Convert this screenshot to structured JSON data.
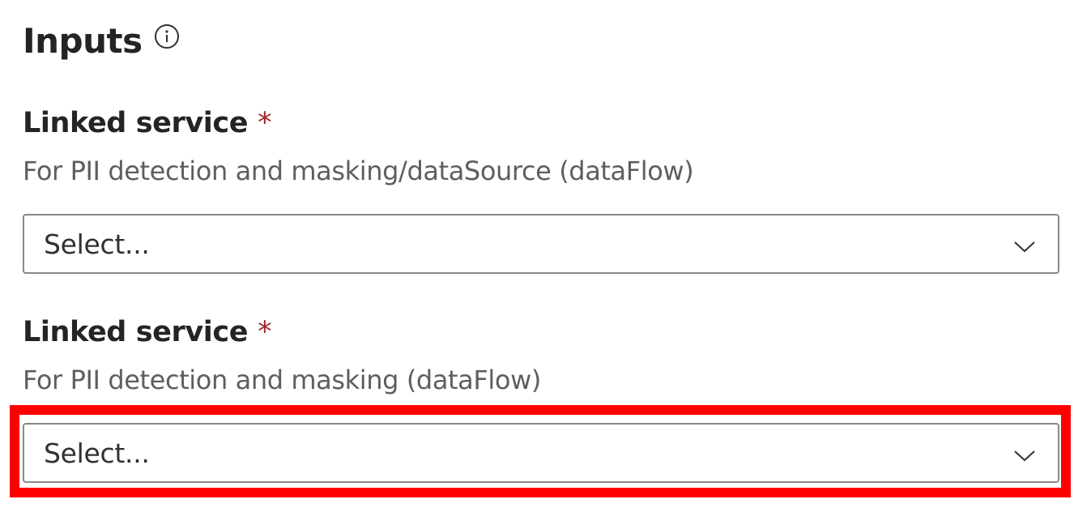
{
  "section": {
    "title": "Inputs",
    "info_icon": "info-icon"
  },
  "fields": [
    {
      "label": "Linked service",
      "required_marker": "*",
      "description": "For PII detection and masking/dataSource (dataFlow)",
      "dropdown_value": "Select..."
    },
    {
      "label": "Linked service",
      "required_marker": "*",
      "description": "For PII detection and masking (dataFlow)",
      "dropdown_value": "Select..."
    }
  ],
  "colors": {
    "required": "#a4262c",
    "highlight": "#ff0000",
    "border": "#8a8886"
  }
}
